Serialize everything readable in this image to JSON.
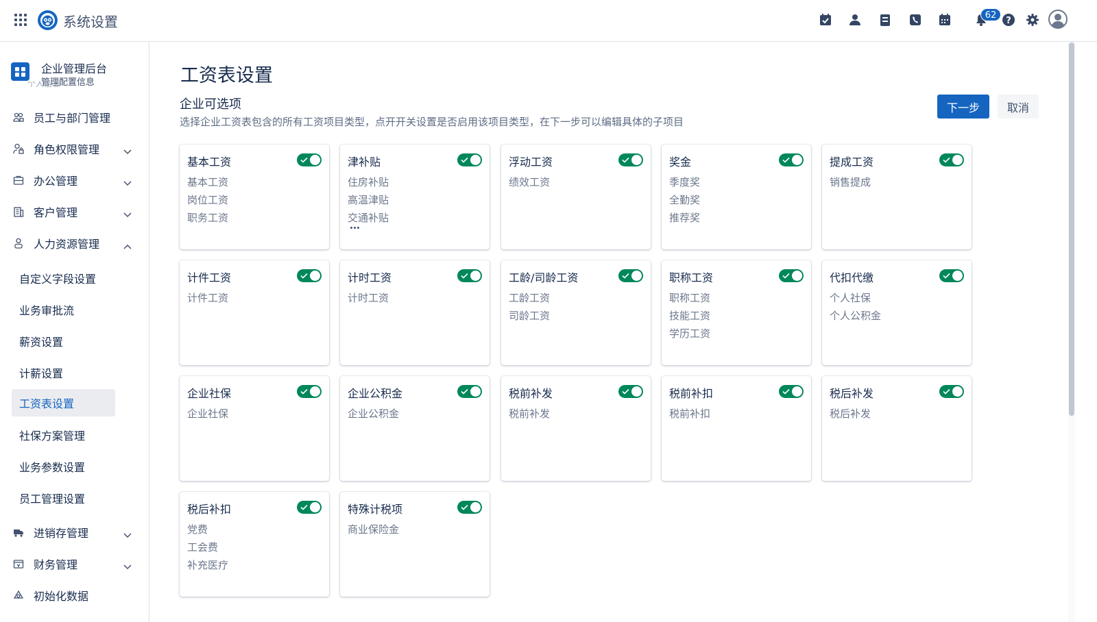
{
  "app": {
    "title": "系统设置"
  },
  "topbar": {
    "icons": [
      "calendar-check-icon",
      "contact-icon",
      "document-icon",
      "phone-icon",
      "calendar-icon",
      "bell-icon",
      "help-icon",
      "gear-icon",
      "avatar-icon"
    ],
    "notification_count": "62"
  },
  "sidebar": {
    "header": {
      "title": "企业管理后台",
      "subtitle": "管理配置信息"
    },
    "clipped_text": "个人信息",
    "items": [
      {
        "label": "员工与部门管理",
        "icon": "org-icon",
        "expandable": false
      },
      {
        "label": "角色权限管理",
        "icon": "user-lock-icon",
        "expandable": true,
        "expanded": false
      },
      {
        "label": "办公管理",
        "icon": "briefcase-icon",
        "expandable": true,
        "expanded": false
      },
      {
        "label": "客户管理",
        "icon": "building-icon",
        "expandable": true,
        "expanded": false
      },
      {
        "label": "人力资源管理",
        "icon": "person-icon",
        "expandable": true,
        "expanded": true
      }
    ],
    "sub_items": [
      {
        "label": "自定义字段设置",
        "active": false
      },
      {
        "label": "业务审批流",
        "active": false
      },
      {
        "label": "薪资设置",
        "active": false
      },
      {
        "label": "计薪设置",
        "active": false
      },
      {
        "label": "工资表设置",
        "active": true
      },
      {
        "label": "社保方案管理",
        "active": false
      },
      {
        "label": "业务参数设置",
        "active": false
      },
      {
        "label": "员工管理设置",
        "active": false
      }
    ],
    "bottom_items": [
      {
        "label": "进销存管理",
        "icon": "truck-icon",
        "expandable": true
      },
      {
        "label": "财务管理",
        "icon": "finance-icon",
        "expandable": true
      },
      {
        "label": "初始化数据",
        "icon": "init-icon",
        "expandable": false
      }
    ]
  },
  "main": {
    "page_title": "工资表设置",
    "section_title": "企业可选项",
    "section_desc": "选择企业工资表包含的所有工资项目类型，点开开关设置是否启用该项目类型，在下一步可以编辑具体的子项目",
    "next_label": "下一步",
    "cancel_label": "取消",
    "cards": [
      {
        "title": "基本工资",
        "enabled": true,
        "items": [
          "基本工资",
          "岗位工资",
          "职务工资"
        ],
        "more": false
      },
      {
        "title": "津补贴",
        "enabled": true,
        "items": [
          "住房补贴",
          "高温津贴",
          "交通补贴"
        ],
        "more": true
      },
      {
        "title": "浮动工资",
        "enabled": true,
        "items": [
          "绩效工资"
        ],
        "more": false
      },
      {
        "title": "奖金",
        "enabled": true,
        "items": [
          "季度奖",
          "全勤奖",
          "推荐奖"
        ],
        "more": false
      },
      {
        "title": "提成工资",
        "enabled": true,
        "items": [
          "销售提成"
        ],
        "more": false
      },
      {
        "title": "计件工资",
        "enabled": true,
        "items": [
          "计件工资"
        ],
        "more": false
      },
      {
        "title": "计时工资",
        "enabled": true,
        "items": [
          "计时工资"
        ],
        "more": false
      },
      {
        "title": "工龄/司龄工资",
        "enabled": true,
        "items": [
          "工龄工资",
          "司龄工资"
        ],
        "more": false
      },
      {
        "title": "职称工资",
        "enabled": true,
        "items": [
          "职称工资",
          "技能工资",
          "学历工资"
        ],
        "more": false
      },
      {
        "title": "代扣代缴",
        "enabled": true,
        "items": [
          "个人社保",
          "个人公积金"
        ],
        "more": false
      },
      {
        "title": "企业社保",
        "enabled": true,
        "items": [
          "企业社保"
        ],
        "more": false
      },
      {
        "title": "企业公积金",
        "enabled": true,
        "items": [
          "企业公积金"
        ],
        "more": false
      },
      {
        "title": "税前补发",
        "enabled": true,
        "items": [
          "税前补发"
        ],
        "more": false
      },
      {
        "title": "税前补扣",
        "enabled": true,
        "items": [
          "税前补扣"
        ],
        "more": false
      },
      {
        "title": "税后补发",
        "enabled": true,
        "items": [
          "税后补发"
        ],
        "more": false
      },
      {
        "title": "税后补扣",
        "enabled": true,
        "items": [
          "党费",
          "工会费",
          "补充医疗"
        ],
        "more": false
      },
      {
        "title": "特殊计税项",
        "enabled": true,
        "items": [
          "商业保险金"
        ],
        "more": false
      }
    ]
  },
  "colors": {
    "primary": "#1565c0",
    "toggle_on": "#00875a",
    "active_bg": "#ebecf0"
  }
}
